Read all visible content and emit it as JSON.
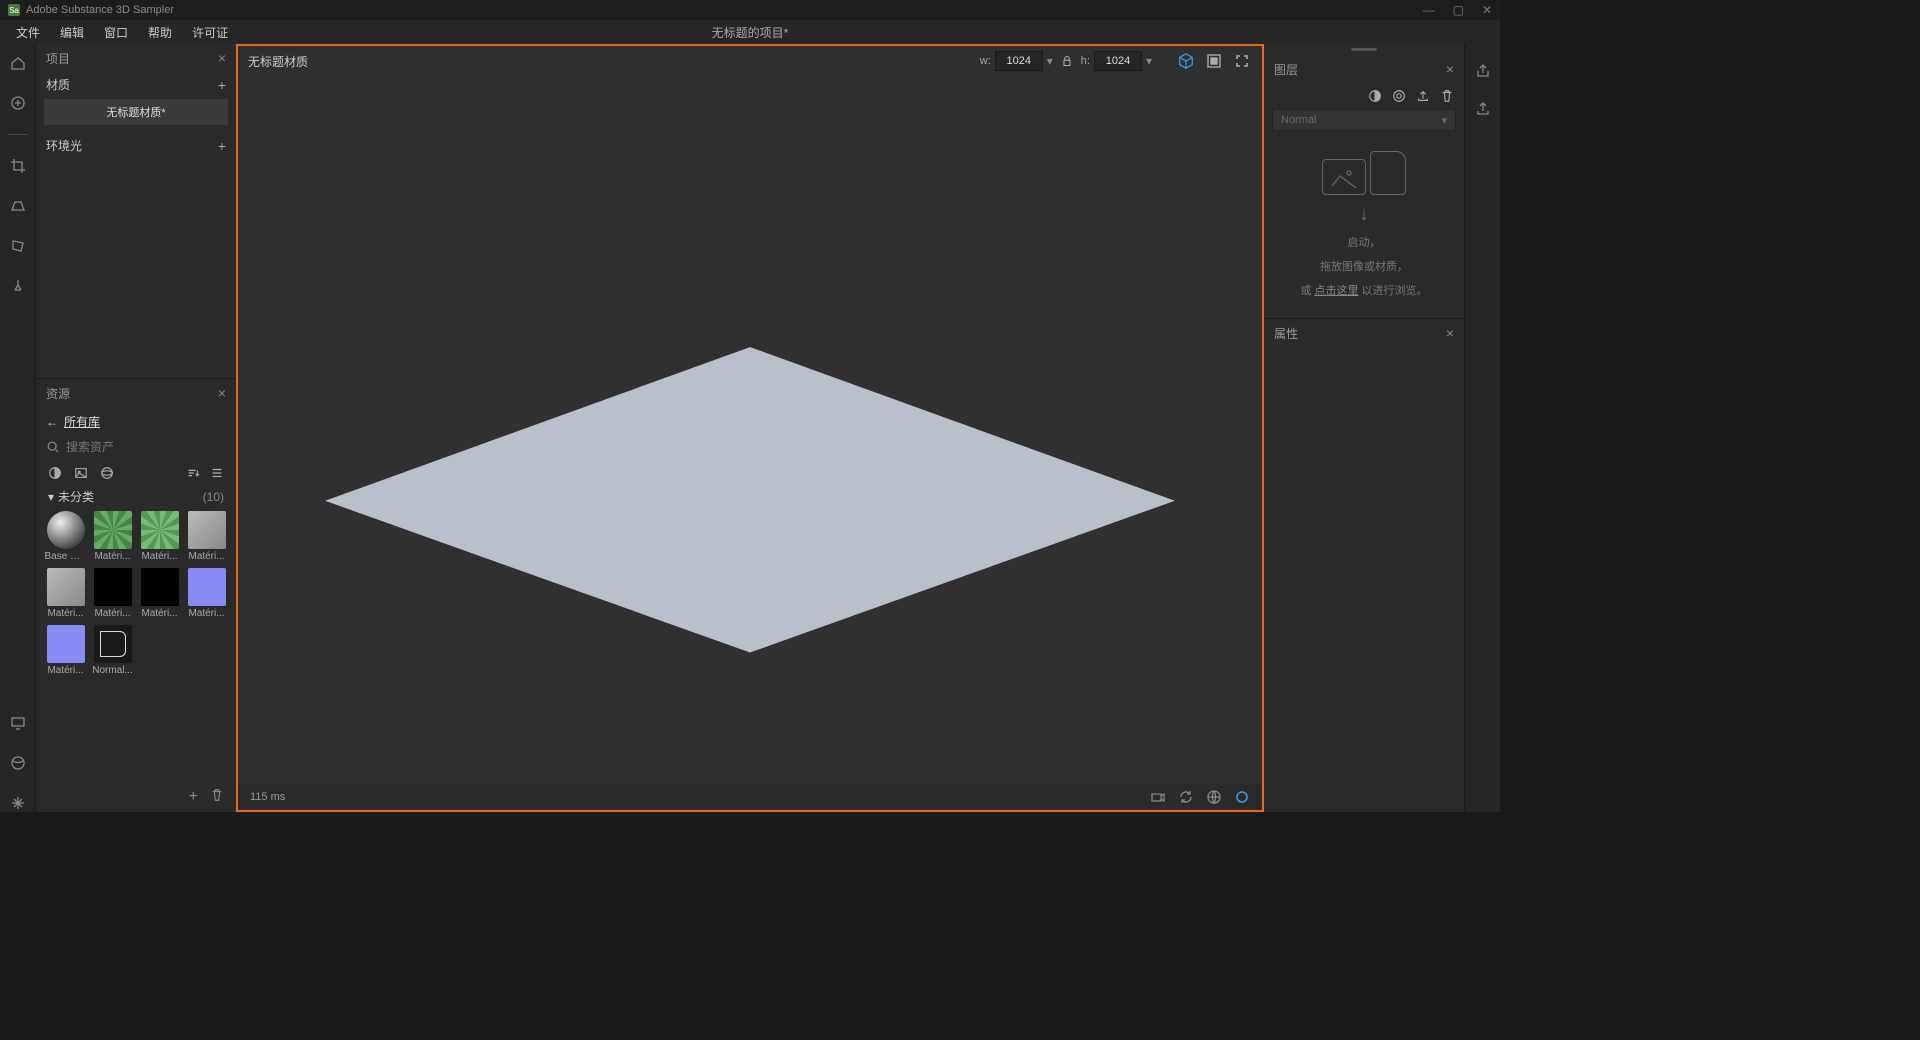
{
  "titlebar": {
    "app_name": "Adobe Substance 3D Sampler"
  },
  "menu": {
    "items": [
      "文件",
      "编辑",
      "窗口",
      "帮助",
      "许可证"
    ],
    "document_title": "无标题的项目*"
  },
  "project_panel": {
    "title": "项目",
    "sections": {
      "materials_label": "材质",
      "material_item": "无标题材质*",
      "environment_label": "环境光"
    }
  },
  "assets_panel": {
    "title": "资源",
    "back_label": "所有库",
    "search_placeholder": "搜索资产",
    "category_label": "未分类",
    "category_count": "(10)",
    "items": [
      {
        "label": "Base M...",
        "thumb": "thumb-sphere"
      },
      {
        "label": "Matéri...",
        "thumb": "thumb-noise1"
      },
      {
        "label": "Matéri...",
        "thumb": "thumb-noise2"
      },
      {
        "label": "Matéri...",
        "thumb": "thumb-gray"
      },
      {
        "label": "Matéri...",
        "thumb": "thumb-gray"
      },
      {
        "label": "Matéri...",
        "thumb": "thumb-black"
      },
      {
        "label": "Matéri...",
        "thumb": "thumb-black"
      },
      {
        "label": "Matéri...",
        "thumb": "thumb-normal"
      },
      {
        "label": "Matéri...",
        "thumb": "thumb-normal"
      },
      {
        "label": "Normal...",
        "thumb": "thumb-nmap"
      }
    ]
  },
  "viewport": {
    "title": "无标题材质",
    "w_label": "w:",
    "w_value": "1024",
    "h_label": "h:",
    "h_value": "1024",
    "render_time": "115 ms"
  },
  "layers_panel": {
    "title": "图层",
    "blend_mode": "Normal",
    "drop_line1": "启动，",
    "drop_line2_a": "拖放图像或材质，",
    "drop_line3_a": "或 ",
    "drop_link": "点击这里",
    "drop_line3_b": " 以进行浏览。"
  },
  "properties_panel": {
    "title": "属性"
  }
}
